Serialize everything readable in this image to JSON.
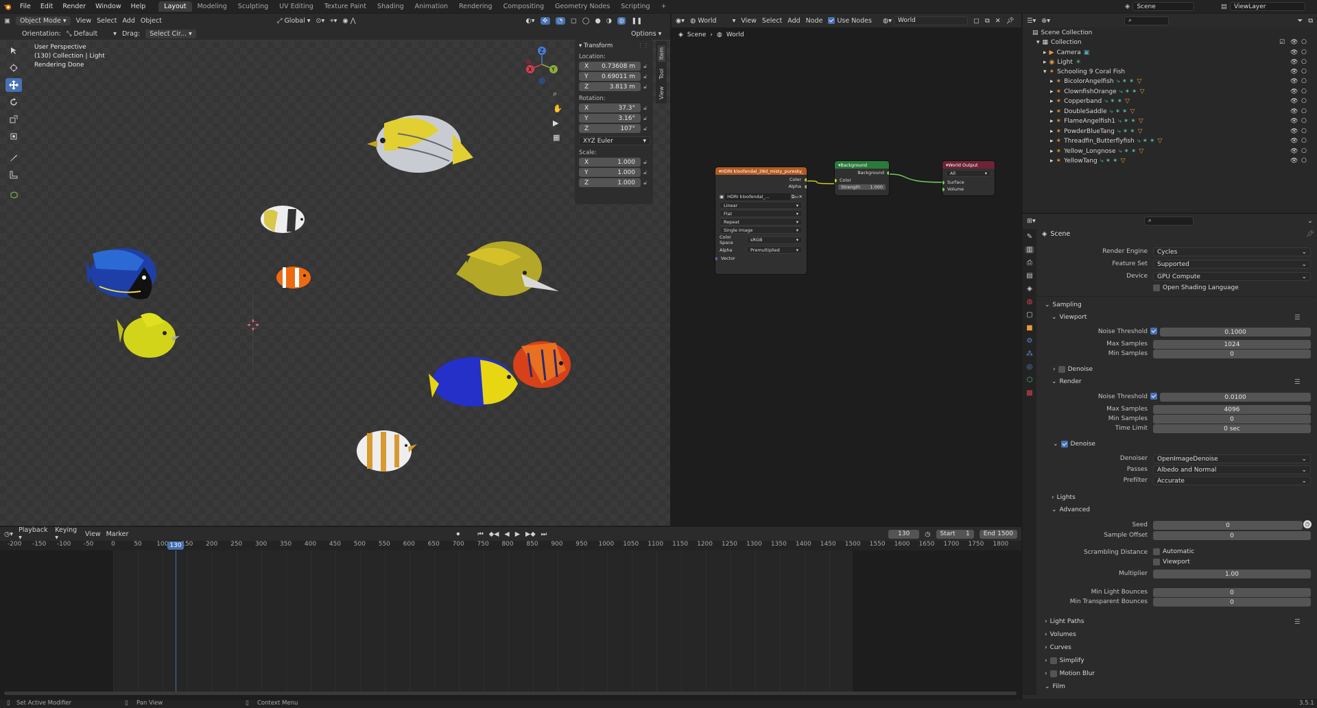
{
  "topbar": {
    "menus": [
      "File",
      "Edit",
      "Render",
      "Window",
      "Help"
    ],
    "workspaces": [
      "Layout",
      "Modeling",
      "Sculpting",
      "UV Editing",
      "Texture Paint",
      "Shading",
      "Animation",
      "Rendering",
      "Compositing",
      "Geometry Nodes",
      "Scripting"
    ],
    "active_workspace": "Layout",
    "scene": "Scene",
    "view_layer": "ViewLayer"
  },
  "viewport": {
    "mode": "Object Mode",
    "menus": [
      "View",
      "Select",
      "Add",
      "Object"
    ],
    "transform_orientation": "Global",
    "orientation_label": "Orientation:",
    "orientation_value": "Default",
    "drag_label": "Drag:",
    "drag_value": "Select Cir...",
    "options": "Options",
    "info_line1": "User Perspective",
    "info_line2": "(130) Collection | Light",
    "info_line3": "Rendering Done"
  },
  "npanel": {
    "title": "Transform",
    "location_label": "Location:",
    "loc": [
      {
        "axis": "X",
        "value": "0.73608 m"
      },
      {
        "axis": "Y",
        "value": "0.69011 m"
      },
      {
        "axis": "Z",
        "value": "3.813 m"
      }
    ],
    "rotation_label": "Rotation:",
    "rot": [
      {
        "axis": "X",
        "value": "37.3°"
      },
      {
        "axis": "Y",
        "value": "3.16°"
      },
      {
        "axis": "Z",
        "value": "107°"
      }
    ],
    "rotation_mode": "XYZ Euler",
    "scale_label": "Scale:",
    "scale": [
      {
        "axis": "X",
        "value": "1.000"
      },
      {
        "axis": "Y",
        "value": "1.000"
      },
      {
        "axis": "Z",
        "value": "1.000"
      }
    ],
    "tabs": [
      "Item",
      "Tool",
      "View"
    ]
  },
  "node_editor": {
    "world_type": "World",
    "menus": [
      "View",
      "Select",
      "Add",
      "Node"
    ],
    "use_nodes": "Use Nodes",
    "world_name": "World",
    "breadcrumb": [
      "Scene",
      "World"
    ],
    "env_node": {
      "title": "HDRI kloofendal_28d_misty_puresky_2...",
      "out_color": "Color",
      "out_alpha": "Alpha",
      "image": "HDRI kloofendal_...",
      "rows": [
        "Linear",
        "Flat",
        "Repeat",
        "Single Image"
      ],
      "colorspace_label": "Color Space",
      "colorspace": "sRGB",
      "alpha_label": "Alpha",
      "alpha": "Premultiplied",
      "vector": "Vector"
    },
    "bg_node": {
      "title": "Background",
      "out": "Background",
      "in_color": "Color",
      "strength_label": "Strength",
      "strength": "1.000"
    },
    "out_node": {
      "title": "World Output",
      "target": "All",
      "surface": "Surface",
      "volume": "Volume"
    }
  },
  "timeline": {
    "menus": [
      "Playback",
      "Keying",
      "View",
      "Marker"
    ],
    "current_frame": "130",
    "start_label": "Start",
    "start": "1",
    "end_label": "End",
    "end": "1500",
    "ticks": [
      "-200",
      "-150",
      "-100",
      "-50",
      "0",
      "50",
      "100",
      "150",
      "200",
      "250",
      "300",
      "350",
      "400",
      "450",
      "500",
      "550",
      "600",
      "650",
      "700",
      "750",
      "800",
      "850",
      "900",
      "950",
      "1000",
      "1050",
      "1100",
      "1150",
      "1200",
      "1250",
      "1300",
      "1350",
      "1400",
      "1450",
      "1500",
      "1550",
      "1600",
      "1650",
      "1700",
      "1750",
      "1800"
    ]
  },
  "outliner": {
    "scene_collection": "Scene Collection",
    "collection": "Collection",
    "camera": "Camera",
    "light": "Light",
    "schooling": "Schooling 9 Coral Fish",
    "fish": [
      "BicolorAngelfish",
      "ClownfishOrange",
      "Copperband",
      "DoubleSaddle",
      "FlameAngelfish1",
      "PowderBlueTang",
      "Threadfin_Butterflyfish",
      "Yellow_Longnose",
      "YellowTang"
    ]
  },
  "properties": {
    "scene": "Scene",
    "render_engine_label": "Render Engine",
    "render_engine": "Cycles",
    "feature_set_label": "Feature Set",
    "feature_set": "Supported",
    "device_label": "Device",
    "device": "GPU Compute",
    "osl": "Open Shading Language",
    "sampling": "Sampling",
    "viewport": "Viewport",
    "noise_threshold_label": "Noise Threshold",
    "vp_noise": "0.1000",
    "max_samples_label": "Max Samples",
    "vp_max": "1024",
    "min_samples_label": "Min Samples",
    "vp_min": "0",
    "denoise": "Denoise",
    "render": "Render",
    "r_noise": "0.0100",
    "r_max": "4096",
    "r_min": "0",
    "time_limit_label": "Time Limit",
    "time_limit": "0 sec",
    "denoiser_label": "Denoiser",
    "denoiser": "OpenImageDenoise",
    "passes_label": "Passes",
    "passes": "Albedo and Normal",
    "prefilter_label": "Prefilter",
    "prefilter": "Accurate",
    "lights": "Lights",
    "advanced": "Advanced",
    "seed_label": "Seed",
    "seed": "0",
    "sample_offset_label": "Sample Offset",
    "sample_offset": "0",
    "scrambling_label": "Scrambling Distance",
    "automatic": "Automatic",
    "viewport_chk": "Viewport",
    "multiplier_label": "Multiplier",
    "multiplier": "1.00",
    "min_light_label": "Min Light Bounces",
    "min_light": "0",
    "min_transp_label": "Min Transparent Bounces",
    "min_transp": "0",
    "collapsed": [
      "Light Paths",
      "Volumes",
      "Curves",
      "Simplify",
      "Motion Blur",
      "Film"
    ]
  },
  "statusbar": {
    "left": "Set Active Modifier",
    "mid": "Pan View",
    "right": "Context Menu",
    "version": "3.5.1"
  },
  "colors": {
    "accent": "#4772b3",
    "bg": "#1d1d1d",
    "panel": "#2c2c2c",
    "viewport": "#393939"
  }
}
